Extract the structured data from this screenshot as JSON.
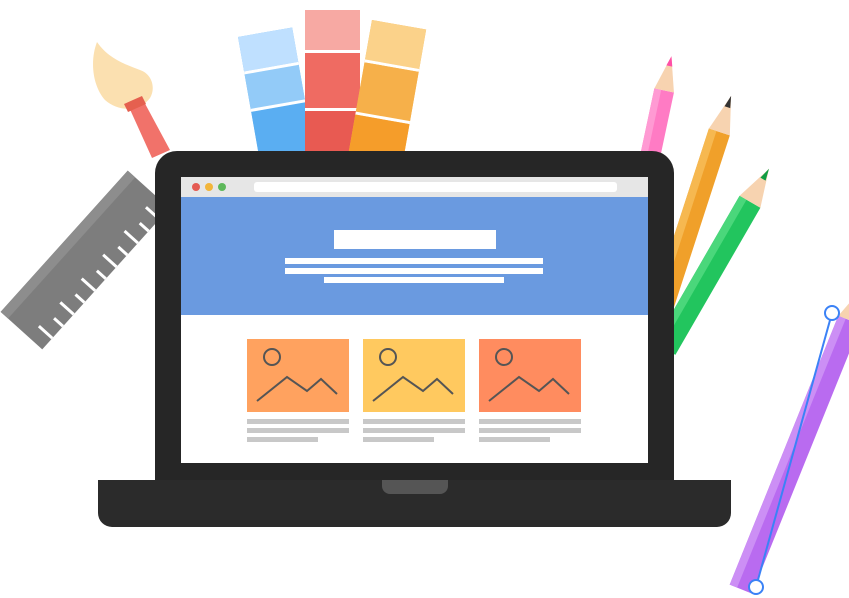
{
  "illustration": {
    "subject": "web-design-laptop",
    "colors": {
      "laptop_body": "#262626",
      "laptop_base": "#2b2b2b",
      "hero_blue": "#6a9ae0",
      "card_orange": "#ffa25f",
      "card_yellow": "#ffc95f",
      "card_coral": "#ff8c5f",
      "card_line": "#c8c8c8",
      "dot_red": "#e45a52",
      "dot_yellow": "#f2b53a",
      "dot_green": "#5db85a",
      "ruler": "#7d7d7d",
      "brush_handle": "#f1726a",
      "brush_head": "#fbe0b0",
      "swatch_blue": "#79bff5",
      "swatch_red": "#f07c78",
      "swatch_orange": "#f7b54d",
      "pencil_pink": "#ff7bc4",
      "pencil_orange": "#f0a02a",
      "pencil_green": "#22c55e",
      "pencil_purple": "#b96bf0"
    },
    "icons": [
      "ruler-icon",
      "paintbrush-icon",
      "color-swatch-icon",
      "pencil-icon",
      "image-placeholder-icon"
    ]
  }
}
